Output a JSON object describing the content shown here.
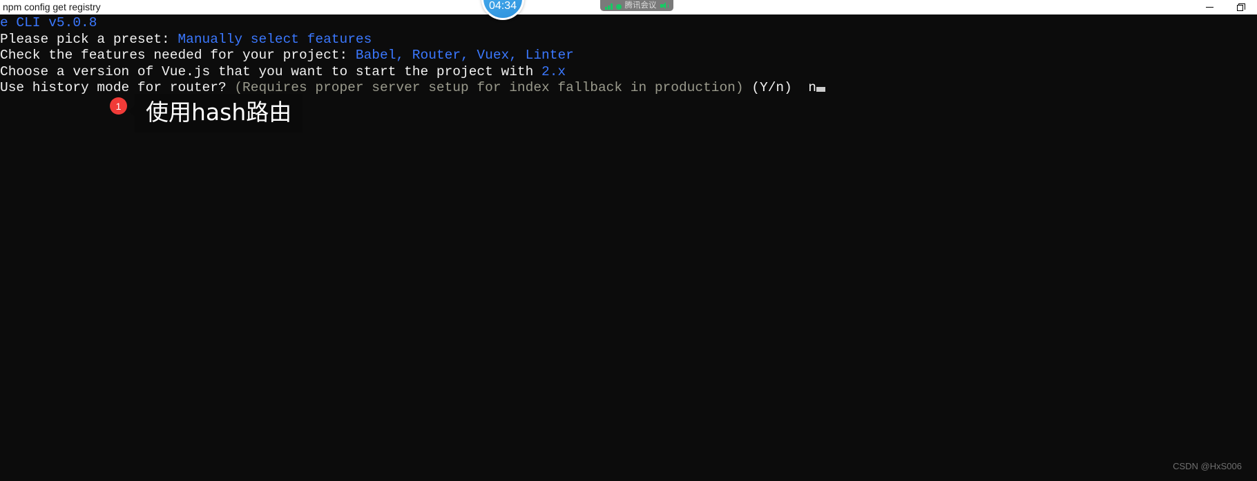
{
  "titlebar": {
    "title": "npm config get registry",
    "minimize_label": "Minimize",
    "restore_label": "Restore"
  },
  "overlay": {
    "timer": "04:34",
    "meeting_app": "腾讯会议"
  },
  "terminal": {
    "lines": [
      {
        "segments": [
          {
            "text": "e CLI v5.0.8",
            "color": "blue"
          }
        ]
      },
      {
        "segments": [
          {
            "text": "Please pick a preset: ",
            "color": "white"
          },
          {
            "text": "Manually select features",
            "color": "blue"
          }
        ]
      },
      {
        "segments": [
          {
            "text": "Check the features needed for your project: ",
            "color": "white"
          },
          {
            "text": "Babel, Router, Vuex, Linter",
            "color": "blue"
          }
        ]
      },
      {
        "segments": [
          {
            "text": "Choose a version of Vue.js that you want to start the project with ",
            "color": "white"
          },
          {
            "text": "2.x",
            "color": "blue"
          }
        ]
      },
      {
        "segments": [
          {
            "text": "Use history mode for router? ",
            "color": "white"
          },
          {
            "text": "(Requires proper server setup for index fallback in production)",
            "color": "dim"
          },
          {
            "text": " (Y/n) ",
            "color": "white"
          },
          {
            "text": " n",
            "color": "white"
          }
        ]
      }
    ],
    "prompt_answer": "n"
  },
  "annotation": {
    "badge": "1",
    "text": "使用hash路由"
  },
  "watermark": {
    "text": "CSDN @HxS006"
  },
  "colors": {
    "terminal_background": "#0c0c0c",
    "terminal_blue": "#3b78ff",
    "terminal_white": "#f2f2f2",
    "terminal_dim": "#9a9a8c",
    "badge_red": "#f03b38",
    "meeting_green": "#17c964",
    "timer_blue": "#3fa3e8"
  }
}
